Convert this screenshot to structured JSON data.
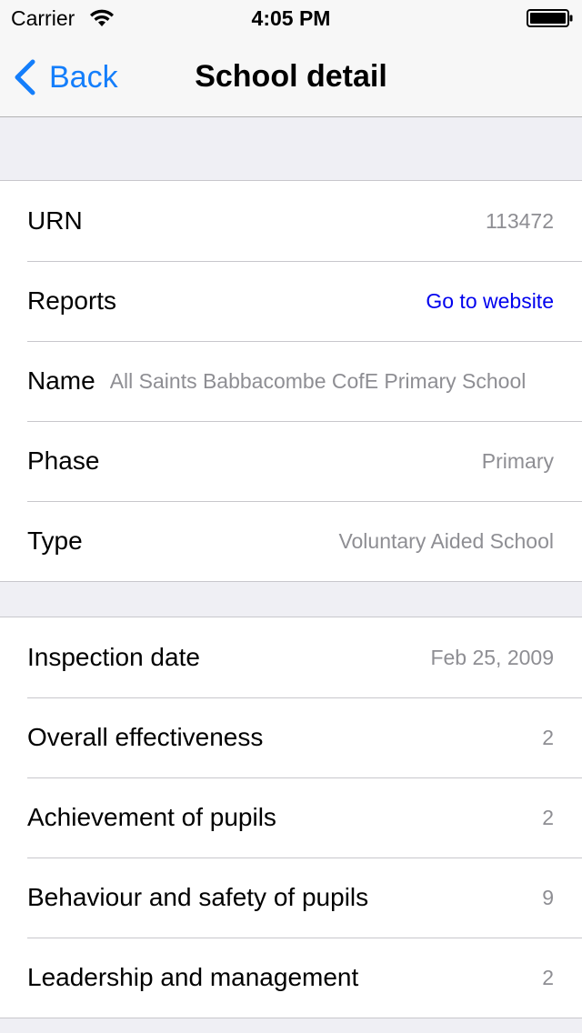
{
  "status_bar": {
    "carrier": "Carrier",
    "time": "4:05 PM"
  },
  "nav": {
    "back_label": "Back",
    "title": "School detail",
    "accent_color": "#147efb"
  },
  "school_info": {
    "urn": {
      "label": "URN",
      "value": "113472"
    },
    "reports": {
      "label": "Reports",
      "value": "Go to website"
    },
    "name": {
      "label": "Name",
      "value": "All Saints Babbacombe CofE Primary School"
    },
    "phase": {
      "label": "Phase",
      "value": "Primary"
    },
    "type": {
      "label": "Type",
      "value": "Voluntary Aided School"
    }
  },
  "inspection": {
    "date": {
      "label": "Inspection date",
      "value": "Feb 25, 2009"
    },
    "overall": {
      "label": "Overall effectiveness",
      "value": "2"
    },
    "achievement": {
      "label": "Achievement of pupils",
      "value": "2"
    },
    "behaviour": {
      "label": "Behaviour and safety of pupils",
      "value": "9"
    },
    "leadership": {
      "label": "Leadership and management",
      "value": "2"
    }
  }
}
